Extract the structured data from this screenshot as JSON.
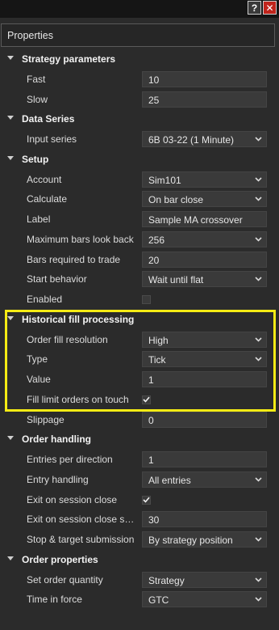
{
  "window": {
    "help_label": "?",
    "close_label": "✕",
    "title": "Properties"
  },
  "highlight_color": "#f5eb14",
  "grid": [
    {
      "kind": "category",
      "label": "Strategy parameters"
    },
    {
      "kind": "text",
      "label": "Fast",
      "value": "10"
    },
    {
      "kind": "text",
      "label": "Slow",
      "value": "25"
    },
    {
      "kind": "category",
      "label": "Data Series"
    },
    {
      "kind": "select",
      "label": "Input series",
      "value": "6B 03-22 (1 Minute)"
    },
    {
      "kind": "category",
      "label": "Setup"
    },
    {
      "kind": "select",
      "label": "Account",
      "value": "Sim101"
    },
    {
      "kind": "select",
      "label": "Calculate",
      "value": "On bar close"
    },
    {
      "kind": "text",
      "label": "Label",
      "value": "Sample MA crossover"
    },
    {
      "kind": "select",
      "label": "Maximum bars look back",
      "value": "256"
    },
    {
      "kind": "text",
      "label": "Bars required to trade",
      "value": "20"
    },
    {
      "kind": "select",
      "label": "Start behavior",
      "value": "Wait until flat"
    },
    {
      "kind": "checkbox",
      "label": "Enabled",
      "checked": false
    },
    {
      "kind": "category",
      "label": "Historical fill processing"
    },
    {
      "kind": "select",
      "label": "Order fill resolution",
      "value": "High"
    },
    {
      "kind": "select",
      "label": "Type",
      "value": "Tick"
    },
    {
      "kind": "text",
      "label": "Value",
      "value": "1"
    },
    {
      "kind": "checkbox",
      "label": "Fill limit orders on touch",
      "checked": true
    },
    {
      "kind": "text",
      "label": "Slippage",
      "value": "0"
    },
    {
      "kind": "category",
      "label": "Order handling"
    },
    {
      "kind": "text",
      "label": "Entries per direction",
      "value": "1"
    },
    {
      "kind": "select",
      "label": "Entry handling",
      "value": "All entries"
    },
    {
      "kind": "checkbox",
      "label": "Exit on session close",
      "checked": true
    },
    {
      "kind": "text",
      "label": "Exit on session close seconds",
      "value": "30"
    },
    {
      "kind": "select",
      "label": "Stop & target submission",
      "value": "By strategy position"
    },
    {
      "kind": "category",
      "label": "Order properties"
    },
    {
      "kind": "select",
      "label": "Set order quantity",
      "value": "Strategy"
    },
    {
      "kind": "select",
      "label": "Time in force",
      "value": "GTC"
    }
  ]
}
